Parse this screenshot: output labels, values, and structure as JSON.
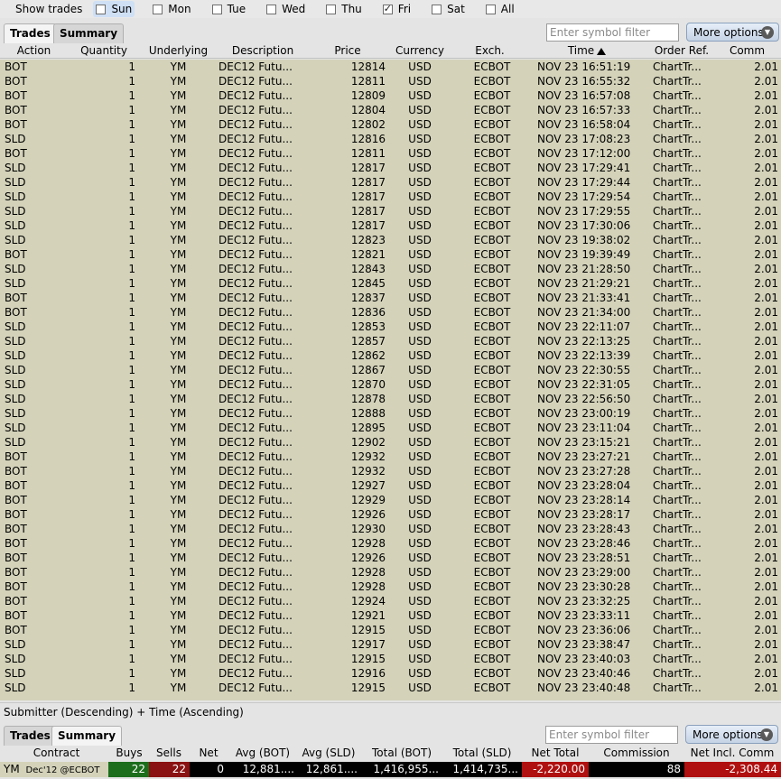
{
  "days": {
    "label": "Show trades",
    "items": [
      {
        "label": "Sun",
        "checked": false,
        "focused": true
      },
      {
        "label": "Mon",
        "checked": false
      },
      {
        "label": "Tue",
        "checked": false
      },
      {
        "label": "Wed",
        "checked": false
      },
      {
        "label": "Thu",
        "checked": false
      },
      {
        "label": "Fri",
        "checked": true
      },
      {
        "label": "Sat",
        "checked": false
      },
      {
        "label": "All",
        "checked": false
      }
    ]
  },
  "tabs": {
    "trades": "Trades",
    "summary": "Summary"
  },
  "filter_placeholder": "Enter symbol filter",
  "more_options": "More options",
  "columns": {
    "action": "Action",
    "quantity": "Quantity",
    "underlying": "Underlying",
    "description": "Description",
    "price": "Price",
    "currency": "Currency",
    "exch": "Exch.",
    "time": "Time",
    "order_ref": "Order Ref.",
    "comm": "Comm"
  },
  "trades": [
    [
      "BOT",
      "1",
      "YM",
      "DEC12 Futu...",
      "12814",
      "USD",
      "ECBOT",
      "NOV 23 16:51:19",
      "ChartTr...",
      "2.01"
    ],
    [
      "BOT",
      "1",
      "YM",
      "DEC12 Futu...",
      "12811",
      "USD",
      "ECBOT",
      "NOV 23 16:55:32",
      "ChartTr...",
      "2.01"
    ],
    [
      "BOT",
      "1",
      "YM",
      "DEC12 Futu...",
      "12809",
      "USD",
      "ECBOT",
      "NOV 23 16:57:08",
      "ChartTr...",
      "2.01"
    ],
    [
      "BOT",
      "1",
      "YM",
      "DEC12 Futu...",
      "12804",
      "USD",
      "ECBOT",
      "NOV 23 16:57:33",
      "ChartTr...",
      "2.01"
    ],
    [
      "BOT",
      "1",
      "YM",
      "DEC12 Futu...",
      "12802",
      "USD",
      "ECBOT",
      "NOV 23 16:58:04",
      "ChartTr...",
      "2.01"
    ],
    [
      "SLD",
      "1",
      "YM",
      "DEC12 Futu...",
      "12816",
      "USD",
      "ECBOT",
      "NOV 23 17:08:23",
      "ChartTr...",
      "2.01"
    ],
    [
      "BOT",
      "1",
      "YM",
      "DEC12 Futu...",
      "12811",
      "USD",
      "ECBOT",
      "NOV 23 17:12:00",
      "ChartTr...",
      "2.01"
    ],
    [
      "SLD",
      "1",
      "YM",
      "DEC12 Futu...",
      "12817",
      "USD",
      "ECBOT",
      "NOV 23 17:29:41",
      "ChartTr...",
      "2.01"
    ],
    [
      "SLD",
      "1",
      "YM",
      "DEC12 Futu...",
      "12817",
      "USD",
      "ECBOT",
      "NOV 23 17:29:44",
      "ChartTr...",
      "2.01"
    ],
    [
      "SLD",
      "1",
      "YM",
      "DEC12 Futu...",
      "12817",
      "USD",
      "ECBOT",
      "NOV 23 17:29:54",
      "ChartTr...",
      "2.01"
    ],
    [
      "SLD",
      "1",
      "YM",
      "DEC12 Futu...",
      "12817",
      "USD",
      "ECBOT",
      "NOV 23 17:29:55",
      "ChartTr...",
      "2.01"
    ],
    [
      "SLD",
      "1",
      "YM",
      "DEC12 Futu...",
      "12817",
      "USD",
      "ECBOT",
      "NOV 23 17:30:06",
      "ChartTr...",
      "2.01"
    ],
    [
      "SLD",
      "1",
      "YM",
      "DEC12 Futu...",
      "12823",
      "USD",
      "ECBOT",
      "NOV 23 19:38:02",
      "ChartTr...",
      "2.01"
    ],
    [
      "BOT",
      "1",
      "YM",
      "DEC12 Futu...",
      "12821",
      "USD",
      "ECBOT",
      "NOV 23 19:39:49",
      "ChartTr...",
      "2.01"
    ],
    [
      "SLD",
      "1",
      "YM",
      "DEC12 Futu...",
      "12843",
      "USD",
      "ECBOT",
      "NOV 23 21:28:50",
      "ChartTr...",
      "2.01"
    ],
    [
      "SLD",
      "1",
      "YM",
      "DEC12 Futu...",
      "12845",
      "USD",
      "ECBOT",
      "NOV 23 21:29:21",
      "ChartTr...",
      "2.01"
    ],
    [
      "BOT",
      "1",
      "YM",
      "DEC12 Futu...",
      "12837",
      "USD",
      "ECBOT",
      "NOV 23 21:33:41",
      "ChartTr...",
      "2.01"
    ],
    [
      "BOT",
      "1",
      "YM",
      "DEC12 Futu...",
      "12836",
      "USD",
      "ECBOT",
      "NOV 23 21:34:00",
      "ChartTr...",
      "2.01"
    ],
    [
      "SLD",
      "1",
      "YM",
      "DEC12 Futu...",
      "12853",
      "USD",
      "ECBOT",
      "NOV 23 22:11:07",
      "ChartTr...",
      "2.01"
    ],
    [
      "SLD",
      "1",
      "YM",
      "DEC12 Futu...",
      "12857",
      "USD",
      "ECBOT",
      "NOV 23 22:13:25",
      "ChartTr...",
      "2.01"
    ],
    [
      "SLD",
      "1",
      "YM",
      "DEC12 Futu...",
      "12862",
      "USD",
      "ECBOT",
      "NOV 23 22:13:39",
      "ChartTr...",
      "2.01"
    ],
    [
      "SLD",
      "1",
      "YM",
      "DEC12 Futu...",
      "12867",
      "USD",
      "ECBOT",
      "NOV 23 22:30:55",
      "ChartTr...",
      "2.01"
    ],
    [
      "SLD",
      "1",
      "YM",
      "DEC12 Futu...",
      "12870",
      "USD",
      "ECBOT",
      "NOV 23 22:31:05",
      "ChartTr...",
      "2.01"
    ],
    [
      "SLD",
      "1",
      "YM",
      "DEC12 Futu...",
      "12878",
      "USD",
      "ECBOT",
      "NOV 23 22:56:50",
      "ChartTr...",
      "2.01"
    ],
    [
      "SLD",
      "1",
      "YM",
      "DEC12 Futu...",
      "12888",
      "USD",
      "ECBOT",
      "NOV 23 23:00:19",
      "ChartTr...",
      "2.01"
    ],
    [
      "SLD",
      "1",
      "YM",
      "DEC12 Futu...",
      "12895",
      "USD",
      "ECBOT",
      "NOV 23 23:11:04",
      "ChartTr...",
      "2.01"
    ],
    [
      "SLD",
      "1",
      "YM",
      "DEC12 Futu...",
      "12902",
      "USD",
      "ECBOT",
      "NOV 23 23:15:21",
      "ChartTr...",
      "2.01"
    ],
    [
      "BOT",
      "1",
      "YM",
      "DEC12 Futu...",
      "12932",
      "USD",
      "ECBOT",
      "NOV 23 23:27:21",
      "ChartTr...",
      "2.01"
    ],
    [
      "BOT",
      "1",
      "YM",
      "DEC12 Futu...",
      "12932",
      "USD",
      "ECBOT",
      "NOV 23 23:27:28",
      "ChartTr...",
      "2.01"
    ],
    [
      "BOT",
      "1",
      "YM",
      "DEC12 Futu...",
      "12927",
      "USD",
      "ECBOT",
      "NOV 23 23:28:04",
      "ChartTr...",
      "2.01"
    ],
    [
      "BOT",
      "1",
      "YM",
      "DEC12 Futu...",
      "12929",
      "USD",
      "ECBOT",
      "NOV 23 23:28:14",
      "ChartTr...",
      "2.01"
    ],
    [
      "BOT",
      "1",
      "YM",
      "DEC12 Futu...",
      "12926",
      "USD",
      "ECBOT",
      "NOV 23 23:28:17",
      "ChartTr...",
      "2.01"
    ],
    [
      "BOT",
      "1",
      "YM",
      "DEC12 Futu...",
      "12930",
      "USD",
      "ECBOT",
      "NOV 23 23:28:43",
      "ChartTr...",
      "2.01"
    ],
    [
      "BOT",
      "1",
      "YM",
      "DEC12 Futu...",
      "12928",
      "USD",
      "ECBOT",
      "NOV 23 23:28:46",
      "ChartTr...",
      "2.01"
    ],
    [
      "BOT",
      "1",
      "YM",
      "DEC12 Futu...",
      "12926",
      "USD",
      "ECBOT",
      "NOV 23 23:28:51",
      "ChartTr...",
      "2.01"
    ],
    [
      "BOT",
      "1",
      "YM",
      "DEC12 Futu...",
      "12928",
      "USD",
      "ECBOT",
      "NOV 23 23:29:00",
      "ChartTr...",
      "2.01"
    ],
    [
      "BOT",
      "1",
      "YM",
      "DEC12 Futu...",
      "12928",
      "USD",
      "ECBOT",
      "NOV 23 23:30:28",
      "ChartTr...",
      "2.01"
    ],
    [
      "BOT",
      "1",
      "YM",
      "DEC12 Futu...",
      "12924",
      "USD",
      "ECBOT",
      "NOV 23 23:32:25",
      "ChartTr...",
      "2.01"
    ],
    [
      "BOT",
      "1",
      "YM",
      "DEC12 Futu...",
      "12921",
      "USD",
      "ECBOT",
      "NOV 23 23:33:11",
      "ChartTr...",
      "2.01"
    ],
    [
      "BOT",
      "1",
      "YM",
      "DEC12 Futu...",
      "12915",
      "USD",
      "ECBOT",
      "NOV 23 23:36:06",
      "ChartTr...",
      "2.01"
    ],
    [
      "SLD",
      "1",
      "YM",
      "DEC12 Futu...",
      "12917",
      "USD",
      "ECBOT",
      "NOV 23 23:38:47",
      "ChartTr...",
      "2.01"
    ],
    [
      "SLD",
      "1",
      "YM",
      "DEC12 Futu...",
      "12915",
      "USD",
      "ECBOT",
      "NOV 23 23:40:03",
      "ChartTr...",
      "2.01"
    ],
    [
      "SLD",
      "1",
      "YM",
      "DEC12 Futu...",
      "12916",
      "USD",
      "ECBOT",
      "NOV 23 23:40:46",
      "ChartTr...",
      "2.01"
    ],
    [
      "SLD",
      "1",
      "YM",
      "DEC12 Futu...",
      "12915",
      "USD",
      "ECBOT",
      "NOV 23 23:40:48",
      "ChartTr...",
      "2.01"
    ]
  ],
  "status_text": "Submitter (Descending)  +  Time (Ascending)",
  "summary_columns": {
    "contract": "Contract",
    "buys": "Buys",
    "sells": "Sells",
    "net": "Net",
    "avg_bot": "Avg (BOT)",
    "avg_sld": "Avg (SLD)",
    "total_bot": "Total (BOT)",
    "total_sld": "Total (SLD)",
    "net_total": "Net Total",
    "commission": "Commission",
    "net_incl_comm": "Net Incl. Comm"
  },
  "summary_row": {
    "symbol": "YM",
    "contract_detail": "Dec'12 @ECBOT",
    "buys": "22",
    "sells": "22",
    "net": "0",
    "avg_bot": "12,881....",
    "avg_sld": "12,861....",
    "total_bot": "1,416,955...",
    "total_sld": "1,414,735...",
    "net_total": "-2,220.00",
    "commission": "88",
    "net_incl_comm": "-2,308.44"
  },
  "colors": {
    "row_bg": "#d4d3ba",
    "buys_bg": "#1c6e1c",
    "sells_bg": "#8a1212",
    "negative_bg": "#b01010",
    "contract_bg": "#d4d3ba"
  }
}
